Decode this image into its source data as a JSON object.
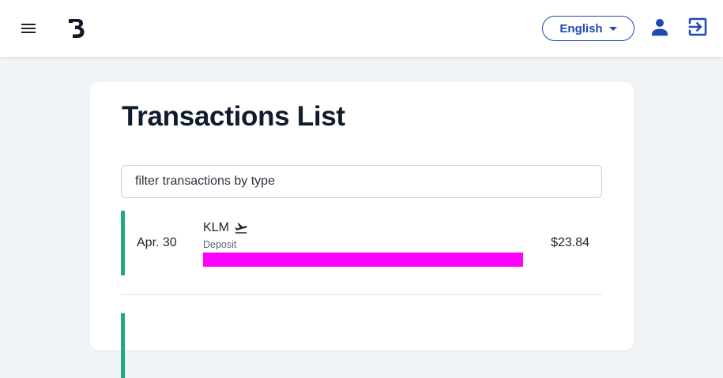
{
  "header": {
    "language_label": "English",
    "icons": [
      "menu-icon",
      "brand-logo-icon",
      "chevron-down-icon",
      "user-icon",
      "logout-icon"
    ]
  },
  "main": {
    "title": "Transactions List",
    "filter": {
      "placeholder": "filter transactions by type",
      "value": ""
    },
    "transactions": [
      {
        "date": "Apr. 30",
        "merchant": "KLM",
        "merchant_icon": "airplane-departure-icon",
        "type": "Deposit",
        "amount": "$23.84",
        "status_color": "#1ea985",
        "highlight_color": "#ff00ff"
      }
    ]
  },
  "colors": {
    "accent": "#1f4ab5",
    "background": "#f1f4f7",
    "title": "#0f1c2e"
  }
}
